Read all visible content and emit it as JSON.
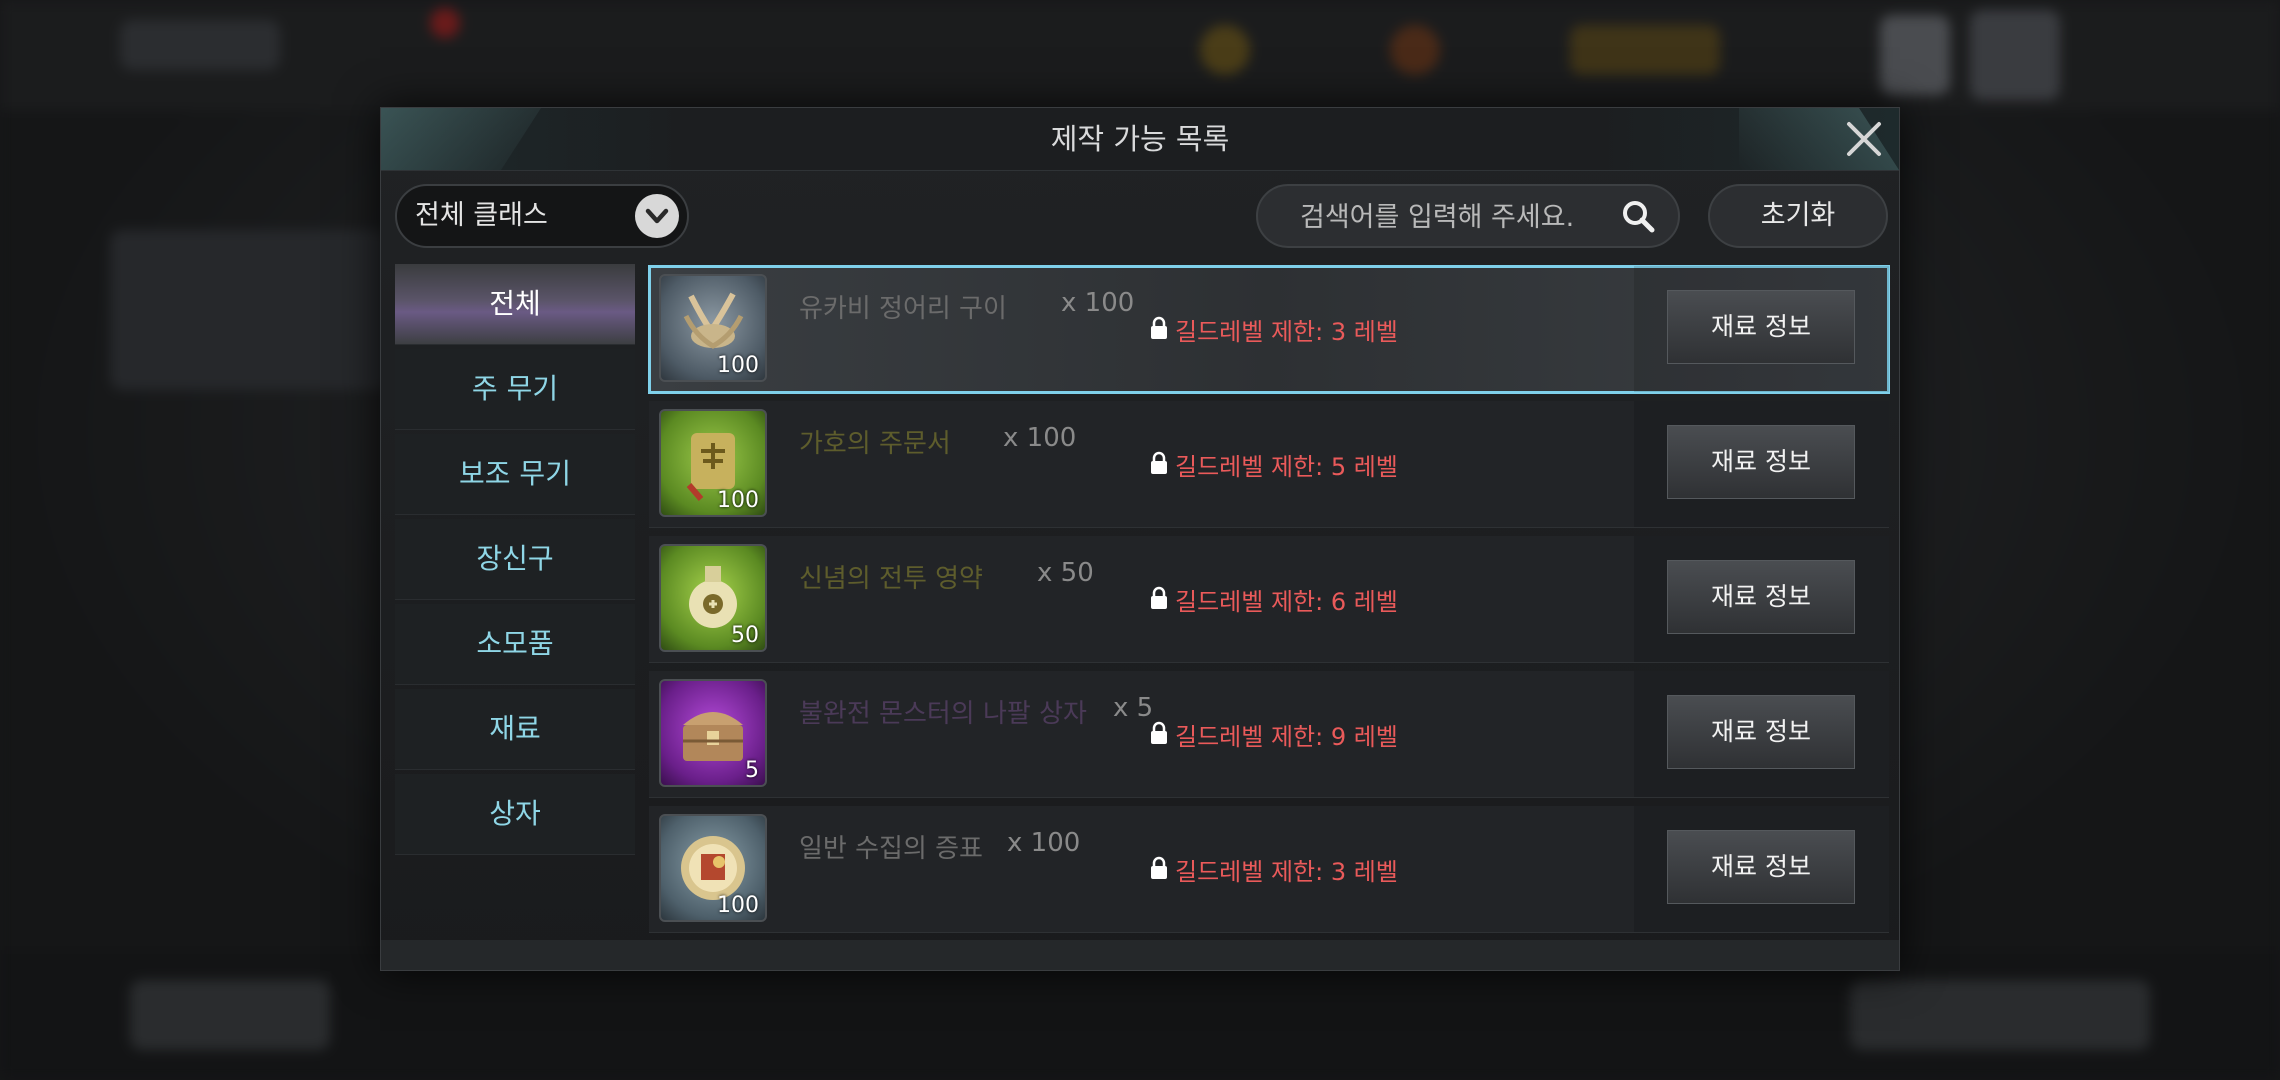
{
  "modal": {
    "title": "제작 가능 목록",
    "class_select": "전체 클래스",
    "search_placeholder": "검색어를 입력해 주세요.",
    "reset_label": "초기화"
  },
  "sidebar": {
    "items": [
      {
        "label": "전체",
        "active": true
      },
      {
        "label": "주 무기"
      },
      {
        "label": "보조 무기"
      },
      {
        "label": "장신구"
      },
      {
        "label": "소모품"
      },
      {
        "label": "재료"
      },
      {
        "label": "상자"
      }
    ]
  },
  "items": [
    {
      "name": "유카비 정어리 구이",
      "mult": "x 100",
      "qty": "100",
      "restriction": "길드레벨 제한: 3 레벨",
      "button": "재료 정보",
      "icon": "fish-icon",
      "name_color": "#6b6b6b"
    },
    {
      "name": "가호의 주문서",
      "mult": "x 100",
      "qty": "100",
      "restriction": "길드레벨 제한: 5 레벨",
      "button": "재료 정보",
      "icon": "scroll-icon",
      "name_color": "#5e5d2c"
    },
    {
      "name": "신념의 전투 영약",
      "mult": "x 50",
      "qty": "50",
      "restriction": "길드레벨 제한: 6 레벨",
      "button": "재료 정보",
      "icon": "potion-icon",
      "name_color": "#5e5d2c"
    },
    {
      "name": "불완전 몬스터의 나팔 상자",
      "mult": "x 5",
      "qty": "5",
      "restriction": "길드레벨 제한: 9 레벨",
      "button": "재료 정보",
      "icon": "chest-icon",
      "name_color": "#4b3a58"
    },
    {
      "name": "일반 수집의 증표",
      "mult": "x 100",
      "qty": "100",
      "restriction": "길드레벨 제한: 3 레벨",
      "button": "재료 정보",
      "icon": "token-icon",
      "name_color": "#6b6b6b"
    }
  ]
}
